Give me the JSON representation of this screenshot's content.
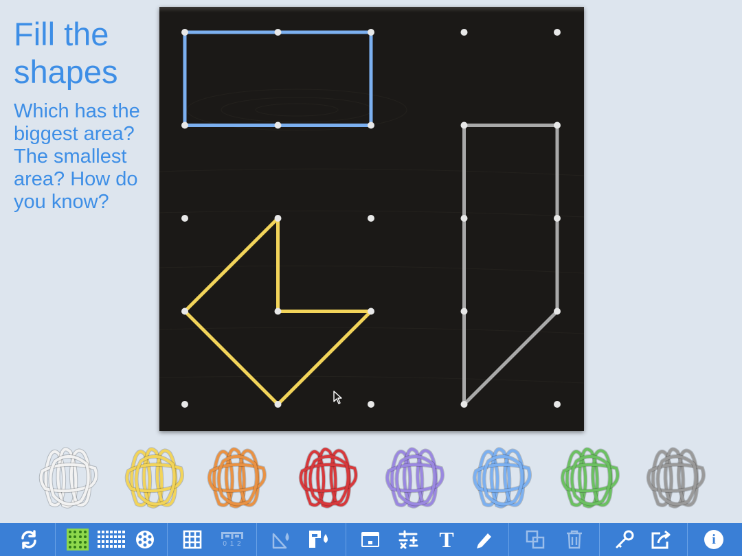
{
  "prompt": {
    "title": "Fill the shapes",
    "question": "Which has the biggest area? The smallest area? How do you know?"
  },
  "geoboard": {
    "grid": "5x5",
    "background": "#1b1917",
    "peg_color": "#e8e8e8",
    "bands": [
      {
        "name": "rectangle",
        "color": "#7cb0f0",
        "pegs": [
          [
            0,
            0
          ],
          [
            2,
            0
          ],
          [
            2,
            1
          ],
          [
            0,
            1
          ]
        ]
      },
      {
        "name": "arrow",
        "color": "#f2d45a",
        "pegs": [
          [
            1,
            2
          ],
          [
            1,
            3
          ],
          [
            2,
            3
          ],
          [
            1,
            4
          ],
          [
            0,
            3
          ]
        ]
      },
      {
        "name": "trapezoid",
        "color": "#a9a9a9",
        "pegs": [
          [
            3,
            1
          ],
          [
            4,
            1
          ],
          [
            4,
            3
          ],
          [
            3,
            4
          ]
        ]
      }
    ]
  },
  "band_tray": [
    {
      "color": "#f2f2f2",
      "name": "white"
    },
    {
      "color": "#f2d45a",
      "name": "yellow"
    },
    {
      "color": "#e99244",
      "name": "orange"
    },
    {
      "color": "#d7393c",
      "name": "red"
    },
    {
      "color": "#9a88e0",
      "name": "purple"
    },
    {
      "color": "#7cb0f0",
      "name": "blue"
    },
    {
      "color": "#6cc062",
      "name": "green"
    },
    {
      "color": "#9a9a9a",
      "name": "gray"
    }
  ],
  "toolbar": {
    "accent": "#3a7fd6",
    "number_line_label": "0 1 2",
    "text_tool_label": "T",
    "info_label": "i"
  }
}
